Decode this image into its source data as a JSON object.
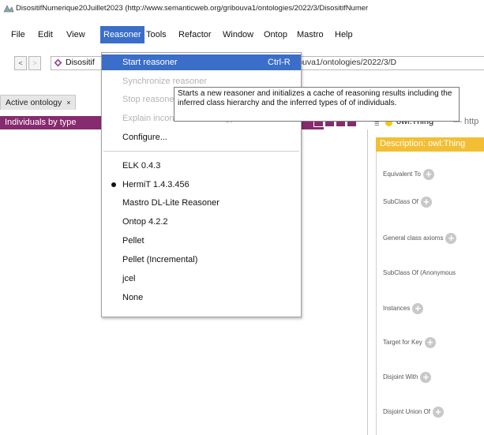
{
  "window": {
    "title": "DisositifNumerique20Juillet2023 (http://www.semanticweb.org/gribouva1/ontologies/2022/3/DisositifNumer"
  },
  "menubar": {
    "items": [
      "File",
      "Edit",
      "View",
      "Reasoner",
      "Tools",
      "Refactor",
      "Window",
      "Ontop",
      "Mastro",
      "Help"
    ],
    "active": "Reasoner"
  },
  "toolbar": {
    "back": "<",
    "forward": ">",
    "ontology_label": "Disositif",
    "url_fragment": "eb.org/gribouva1/ontologies/2022/3/D"
  },
  "tabs": {
    "active_tab": "Active ontology",
    "close": "×"
  },
  "left_panel": {
    "title": "Individuals by type"
  },
  "right_panel": {
    "thing_bars": "≡",
    "thing_name": "owl:Thing",
    "thing_url": "— http",
    "description_title": "Description: owl:Thing",
    "sections": [
      "Equivalent To",
      "SubClass Of",
      "General class axioms",
      "SubClass Of (Anonymous",
      "Instances",
      "Target for Key",
      "Disjoint With",
      "Disjoint Union Of"
    ]
  },
  "reasoner_menu": {
    "items": [
      {
        "label": "Start reasoner",
        "shortcut": "Ctrl-R",
        "state": "highlighted"
      },
      {
        "label": "Synchronize reasoner",
        "state": "disabled"
      },
      {
        "label": "Stop reasoner",
        "state": "disabled"
      },
      {
        "label": "Explain inconsistent ontology",
        "state": "disabled"
      },
      {
        "label": "Configure...",
        "state": "normal"
      }
    ],
    "reasoners": [
      "ELK 0.4.3",
      "HermiT 1.4.3.456",
      "Mastro DL-Lite Reasoner",
      "Ontop 4.2.2",
      "Pellet",
      "Pellet (Incremental)",
      "jcel",
      "None"
    ],
    "selected_reasoner": "HermiT 1.4.3.456"
  },
  "tooltip": {
    "text": "Starts a new reasoner and initializes a cache of reasoning results including the inferred class hierarchy and the inferred types of of individuals."
  },
  "colors": {
    "menu_highlight": "#3a6ec9",
    "panel_header_purple": "#862b6f",
    "description_header_yellow": "#f3be33",
    "thing_dot": "#f2c90f"
  }
}
